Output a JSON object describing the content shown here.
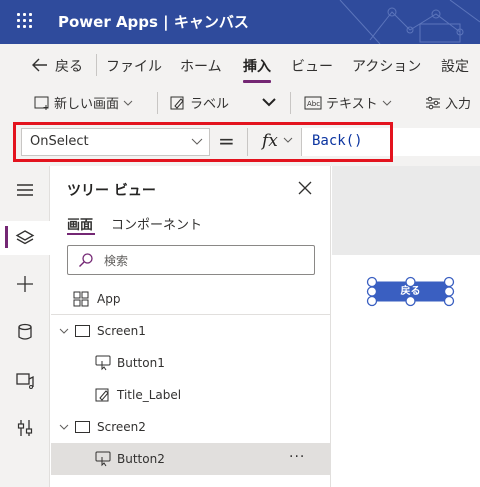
{
  "titlebar": {
    "title": "Power Apps  |  キャンバス"
  },
  "tabs": {
    "back": "戻る",
    "file": "ファイル",
    "home": "ホーム",
    "insert": "挿入",
    "view": "ビュー",
    "action": "アクション",
    "settings": "設定"
  },
  "toolbar": {
    "new_screen": "新しい画面",
    "label": "ラベル",
    "text": "テキスト",
    "input": "入力"
  },
  "formula": {
    "property": "OnSelect",
    "equals": "=",
    "fx": "fx",
    "code": "Back()"
  },
  "tree": {
    "title": "ツリー ビュー",
    "tab_screens": "画面",
    "tab_components": "コンポーネント",
    "search_placeholder": "検索",
    "items": [
      {
        "label": "App"
      },
      {
        "label": "Screen1"
      },
      {
        "label": "Button1"
      },
      {
        "label": "Title_Label"
      },
      {
        "label": "Screen2"
      },
      {
        "label": "Button2"
      }
    ],
    "more": "···"
  },
  "canvas": {
    "button_text": "戻る"
  },
  "colors": {
    "titlebar": "#2f4b9c",
    "accent": "#742774",
    "highlight_box": "#e3131e",
    "canvas_button": "#3a5fc1"
  }
}
